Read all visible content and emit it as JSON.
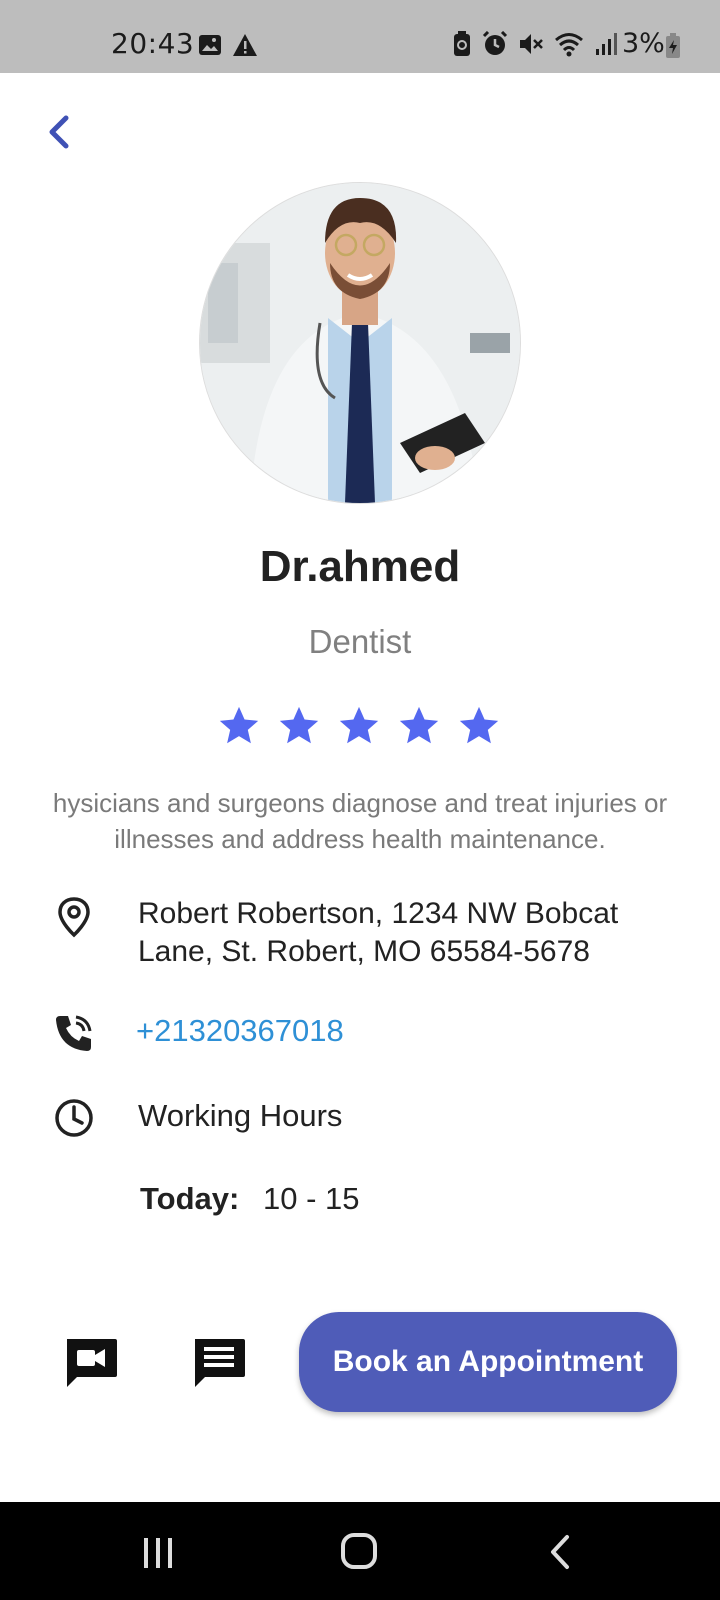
{
  "status_bar": {
    "time": "20:43",
    "battery_text": "3%",
    "icons_left": [
      "image-icon",
      "warning-icon"
    ],
    "icons_right": [
      "battery-saver-icon",
      "alarm-icon",
      "mute-icon",
      "wifi-icon",
      "signal-icon"
    ]
  },
  "doctor": {
    "name": "Dr.ahmed",
    "specialty": "Dentist",
    "rating": 5,
    "rating_max": 5,
    "description": "hysicians and surgeons diagnose and treat injuries or illnesses and address health maintenance.",
    "address": "Robert Robertson, 1234 NW Bobcat Lane, St. Robert, MO 65584-5678",
    "phone": "+21320367018",
    "working_hours_label": "Working Hours",
    "today_label": "Today:",
    "today_hours": "10 - 15"
  },
  "actions": {
    "video_icon": "video-chat-icon",
    "message_icon": "message-icon",
    "book_label": "Book an Appointment"
  },
  "colors": {
    "accent": "#4f5cb8",
    "star": "#5468f0",
    "phone_link": "#2e90d6",
    "back_arrow": "#3f51b5"
  }
}
